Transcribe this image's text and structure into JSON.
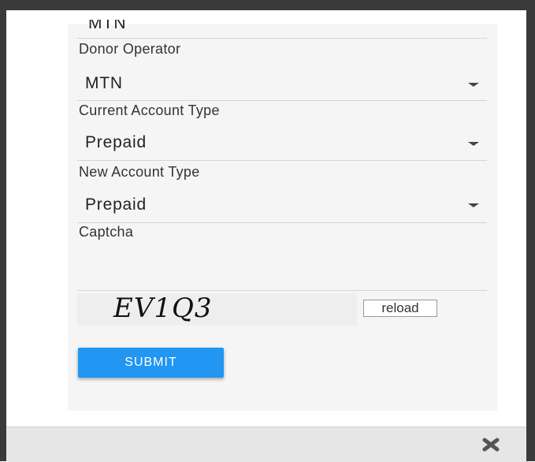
{
  "form": {
    "cut_top_value": "MTN",
    "donor_operator": {
      "label": "Donor Operator",
      "value": "MTN"
    },
    "current_account_type": {
      "label": "Current Account Type",
      "value": "Prepaid"
    },
    "new_account_type": {
      "label": "New Account Type",
      "value": "Prepaid"
    },
    "captcha": {
      "label": "Captcha",
      "code": "EV1Q3",
      "reload_label": "reload"
    },
    "submit_label": "SUBMIT"
  },
  "footer": {
    "close_icon": "close-icon"
  },
  "colors": {
    "submit": "#2196f3",
    "frame": "#3a3a3a",
    "panel": "#f5f5f5"
  }
}
